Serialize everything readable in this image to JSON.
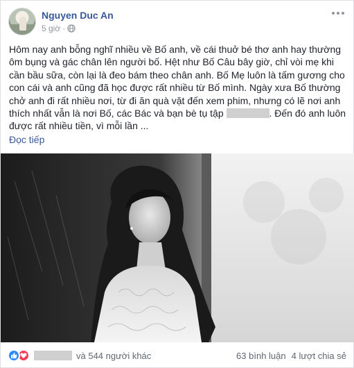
{
  "post": {
    "author": "Nguyen Duc An",
    "time": "5 giờ",
    "separator": "·",
    "text_before": "Hôm nay anh bỗng nghĩ nhiều về Bố anh, về cái thuở bé thơ anh hay thường ôm bụng và gác chân lên người bố. Hệt như Bố Câu bây giờ, chỉ vòi mẹ khi cần bầu sữa, còn lại là đeo bám theo chân anh. Bố Mẹ luôn là tấm gương cho con cái và anh cũng đã học được rất nhiều từ Bố mình. Ngày xưa Bố thường chở anh đi rất nhiều nơi, từ đi ăn quà vặt đến xem phim, nhưng có lẽ nơi anh thích nhất vẫn là nơi Bố, các Bác và bạn bè tụ tập",
    "text_after": ". Đến đó anh luôn được rất nhiều tiền, vì mỗi lần ...",
    "read_more": "Đọc tiếp"
  },
  "footer": {
    "others": "và 544 người khác",
    "comments": "63 bình luận",
    "shares": "4 lượt chia sẻ"
  },
  "colors": {
    "link": "#385898",
    "like": "#2e89ff",
    "love": "#f33e58",
    "muted": "#90949c"
  }
}
